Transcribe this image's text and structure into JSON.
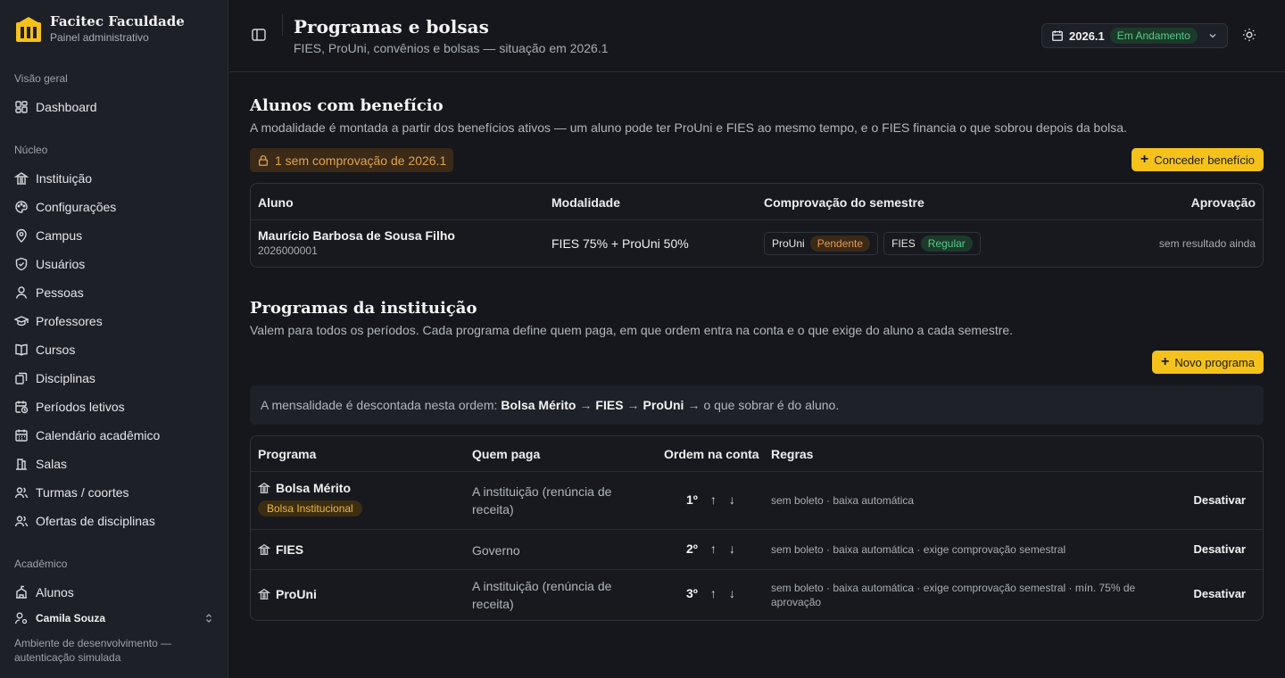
{
  "brand": {
    "name": "Facitec Faculdade",
    "subtitle": "Painel administrativo"
  },
  "sidebar": {
    "sections": [
      {
        "title": "Visão geral",
        "items": [
          {
            "label": "Dashboard",
            "icon": "dashboard-icon"
          }
        ]
      },
      {
        "title": "Núcleo",
        "items": [
          {
            "label": "Instituição",
            "icon": "institution-icon"
          },
          {
            "label": "Configurações",
            "icon": "palette-icon"
          },
          {
            "label": "Campus",
            "icon": "map-pin-icon"
          },
          {
            "label": "Usuários",
            "icon": "shield-icon"
          },
          {
            "label": "Pessoas",
            "icon": "person-icon"
          },
          {
            "label": "Professores",
            "icon": "graduation-cap-icon"
          },
          {
            "label": "Cursos",
            "icon": "book-icon"
          },
          {
            "label": "Disciplinas",
            "icon": "library-icon"
          },
          {
            "label": "Períodos letivos",
            "icon": "calendar-clock-icon"
          },
          {
            "label": "Calendário acadêmico",
            "icon": "calendar-icon"
          },
          {
            "label": "Salas",
            "icon": "rooms-icon"
          },
          {
            "label": "Turmas / coortes",
            "icon": "users-icon"
          },
          {
            "label": "Ofertas de disciplinas",
            "icon": "users-icon"
          }
        ]
      },
      {
        "title": "Acadêmico",
        "items": [
          {
            "label": "Alunos",
            "icon": "school-icon"
          }
        ]
      }
    ],
    "user": {
      "name": "Camila Souza"
    },
    "env_note": "Ambiente de desenvolvimento — autenticação simulada"
  },
  "header": {
    "title": "Programas e bolsas",
    "subtitle": "FIES, ProUni, convênios e bolsas — situação em 2026.1",
    "period": {
      "label": "2026.1",
      "status": "Em Andamento"
    }
  },
  "benefits": {
    "title": "Alunos com benefício",
    "description": "A modalidade é montada a partir dos benefícios ativos — um aluno pode ter ProUni e FIES ao mesmo tempo, e o FIES financia o que sobrou depois da bolsa.",
    "warning": "1 sem comprovação de 2026.1",
    "grant_button": "Conceder benefício",
    "columns": [
      "Aluno",
      "Modalidade",
      "Comprovação do semestre",
      "Aprovação"
    ],
    "rows": [
      {
        "name": "Maurício Barbosa de Sousa Filho",
        "id": "2026000001",
        "modality": "FIES 75% + ProUni 50%",
        "proofs": [
          {
            "program": "ProUni",
            "status": "Pendente"
          },
          {
            "program": "FIES",
            "status": "Regular"
          }
        ],
        "approval": "sem resultado ainda"
      }
    ]
  },
  "programs": {
    "title": "Programas da instituição",
    "description": "Valem para todos os períodos. Cada programa define quem paga, em que ordem entra na conta e o que exige do aluno a cada semestre.",
    "new_button": "Novo programa",
    "order_note": {
      "prefix": "A mensalidade é descontada nesta ordem:",
      "p1": "Bolsa Mérito",
      "p2": "FIES",
      "p3": "ProUni",
      "suffix": "o que sobrar é do aluno."
    },
    "columns": [
      "Programa",
      "Quem paga",
      "Ordem na conta",
      "Regras"
    ],
    "rows": [
      {
        "name": "Bolsa Mérito",
        "tag": "Bolsa Institucional",
        "payer": "A instituição (renúncia de receita)",
        "order": "1º",
        "rules": "sem boleto · baixa automática",
        "action": "Desativar"
      },
      {
        "name": "FIES",
        "tag": "",
        "payer": "Governo",
        "order": "2º",
        "rules": "sem boleto · baixa automática · exige comprovação semestral",
        "action": "Desativar"
      },
      {
        "name": "ProUni",
        "tag": "",
        "payer": "A instituição (renúncia de receita)",
        "order": "3º",
        "rules": "sem boleto · baixa automática · exige comprovação semestral · mín. 75% de aprovação",
        "action": "Desativar"
      }
    ]
  }
}
